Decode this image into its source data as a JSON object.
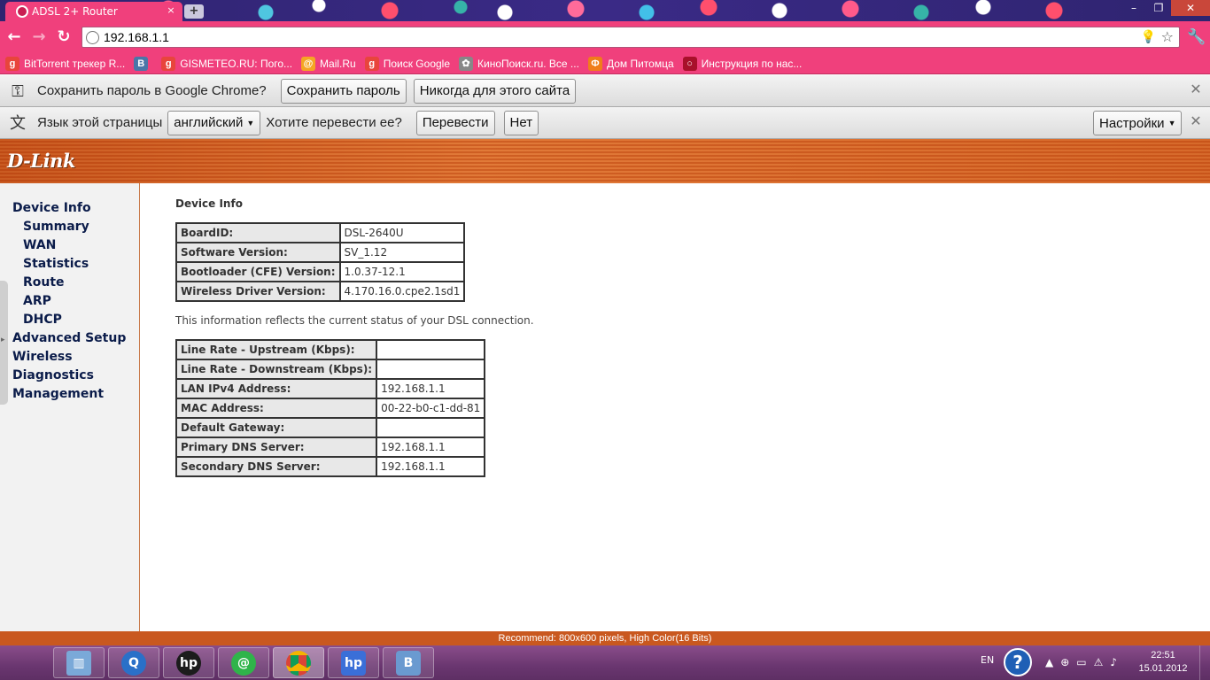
{
  "browser": {
    "tab_title": "ADSL 2+ Router",
    "tab_close": "×",
    "new_tab": "+",
    "url": "192.168.1.1",
    "win_min": "–",
    "win_max": "❐",
    "win_close": "✕"
  },
  "bookmarks": [
    {
      "label": "BitTorrent трекер R...",
      "icon": "g-icon",
      "color": "#e8453c",
      "glyph": "g"
    },
    {
      "label": "",
      "icon": "vk-icon",
      "color": "#4a76a8",
      "glyph": "B"
    },
    {
      "label": "GISMETEO.RU: Пого...",
      "icon": "g-icon",
      "color": "#e8453c",
      "glyph": "g"
    },
    {
      "label": "Mail.Ru",
      "icon": "mailru-icon",
      "color": "#f5a623",
      "glyph": "@"
    },
    {
      "label": "Поиск Google",
      "icon": "g-icon",
      "color": "#e8453c",
      "glyph": "g"
    },
    {
      "label": "КиноПоиск.ru. Все ...",
      "icon": "kinopoisk-icon",
      "color": "#888",
      "glyph": "✿"
    },
    {
      "label": "Дом Питомца",
      "icon": "dom-icon",
      "color": "#f07d1a",
      "glyph": "Ф"
    },
    {
      "label": "Инструкция по нас...",
      "icon": "opera-icon",
      "color": "#a8102a",
      "glyph": "○"
    }
  ],
  "infobar_password": {
    "text": "Сохранить пароль в Google Chrome?",
    "save_button": "Сохранить пароль",
    "never_button": "Никогда для этого сайта",
    "close": "✕"
  },
  "infobar_translate": {
    "text_lang": "Язык этой страницы",
    "lang_select": "английский",
    "question": "Хотите перевести ее?",
    "translate_button": "Перевести",
    "no_button": "Нет",
    "settings_button": "Настройки",
    "close": "✕"
  },
  "router": {
    "logo": "D-Link",
    "nav": {
      "device_info": "Device Info",
      "summary": "Summary",
      "wan": "WAN",
      "statistics": "Statistics",
      "route": "Route",
      "arp": "ARP",
      "dhcp": "DHCP",
      "advanced_setup": "Advanced Setup",
      "wireless": "Wireless",
      "diagnostics": "Diagnostics",
      "management": "Management"
    },
    "section_title": "Device Info",
    "device_table": [
      {
        "key": "BoardID:",
        "value": "DSL-2640U"
      },
      {
        "key": "Software Version:",
        "value": "SV_1.12"
      },
      {
        "key": "Bootloader (CFE) Version:",
        "value": "1.0.37-12.1"
      },
      {
        "key": "Wireless Driver Version:",
        "value": "4.170.16.0.cpe2.1sd1"
      }
    ],
    "note": "This information reflects the current status of your DSL connection.",
    "status_table": [
      {
        "key": "Line Rate - Upstream (Kbps):",
        "value": ""
      },
      {
        "key": "Line Rate - Downstream (Kbps):",
        "value": ""
      },
      {
        "key": "LAN IPv4 Address:",
        "value": "192.168.1.1"
      },
      {
        "key": "MAC Address:",
        "value": "00-22-b0-c1-dd-81"
      },
      {
        "key": "Default Gateway:",
        "value": ""
      },
      {
        "key": "Primary DNS Server:",
        "value": "192.168.1.1"
      },
      {
        "key": "Secondary DNS Server:",
        "value": "192.168.1.1"
      }
    ],
    "recommend": "Recommend: 800x600 pixels, High Color(16 Bits)"
  },
  "taskbar": {
    "lang": "EN",
    "help": "?",
    "time": "22:51",
    "date": "15.01.2012"
  }
}
